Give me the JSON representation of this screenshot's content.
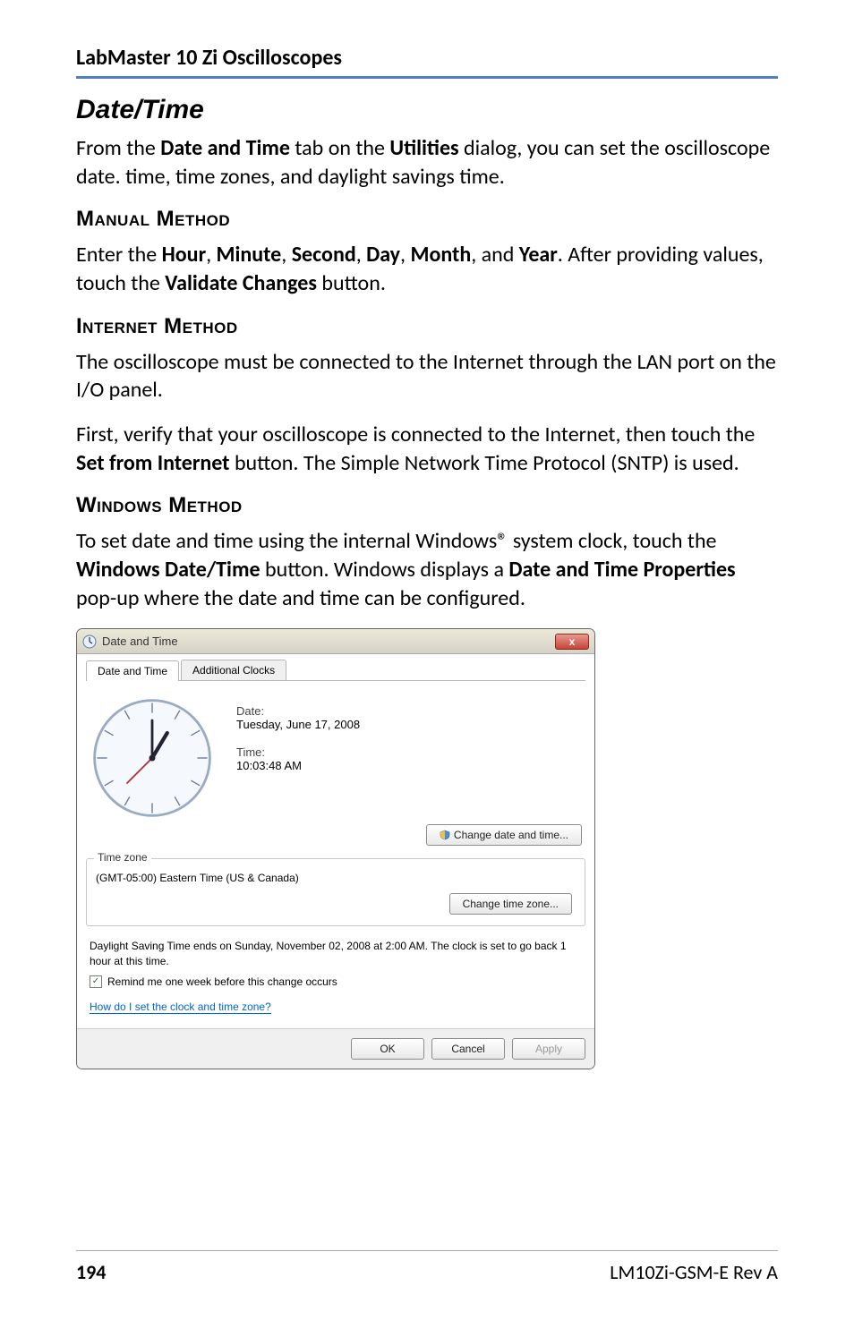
{
  "header": {
    "running_head": "LabMaster 10 Zi Oscilloscopes"
  },
  "section": {
    "title": "Date/Time"
  },
  "intro": {
    "text_a": "From the ",
    "bold_a": "Date and Time",
    "text_b": " tab on the ",
    "bold_b": "Utilities",
    "text_c": " dialog, you can set the oscilloscope date. time, time zones, and daylight savings time."
  },
  "manual": {
    "heading": "Manual Method",
    "p_a": "Enter the ",
    "b1": "Hour",
    "c1": ", ",
    "b2": "Minute",
    "c2": ", ",
    "b3": "Second",
    "c3": ", ",
    "b4": "Day",
    "c4": ", ",
    "b5": "Month",
    "c5": ", and ",
    "b6": "Year",
    "c6": ". After providing values, touch the ",
    "b7": "Validate Changes",
    "c7": " button."
  },
  "internet": {
    "heading": "Internet Method",
    "p1": "The oscilloscope must be connected to the Internet through the LAN port on the I/O panel.",
    "p2_a": "First, verify that your oscilloscope is connected to the Internet, then touch the ",
    "p2_b": "Set from Internet",
    "p2_c": " button. The Simple Network Time Protocol (SNTP) is used."
  },
  "windows": {
    "heading": "Windows Method",
    "p_a": "To set date and time using the internal Windows® system clock, touch the ",
    "b1": "Windows Date/Time",
    "p_b": " button. Windows displays a ",
    "b2": "Date and Time Properties",
    "p_c": " pop-up where the date and time can be configured."
  },
  "dialog": {
    "title": "Date and Time",
    "close_glyph": "x",
    "tabs": {
      "t1": "Date and Time",
      "t2": "Additional Clocks"
    },
    "date_label": "Date:",
    "date_value": "Tuesday, June 17, 2008",
    "time_label": "Time:",
    "time_value": "10:03:48 AM",
    "change_dt_btn": "Change date and time...",
    "tz_legend": "Time zone",
    "tz_value": "(GMT-05:00) Eastern Time (US & Canada)",
    "change_tz_btn": "Change time zone...",
    "dst_note": "Daylight Saving Time ends on Sunday, November 02, 2008 at 2:00 AM. The clock is set to go back 1 hour at this time.",
    "remind_label": "Remind me one week before this change occurs",
    "help_link": "How do I set the clock and time zone?",
    "ok": "OK",
    "cancel": "Cancel",
    "apply": "Apply"
  },
  "footer": {
    "page": "194",
    "doc": "LM10Zi-GSM-E Rev A"
  }
}
